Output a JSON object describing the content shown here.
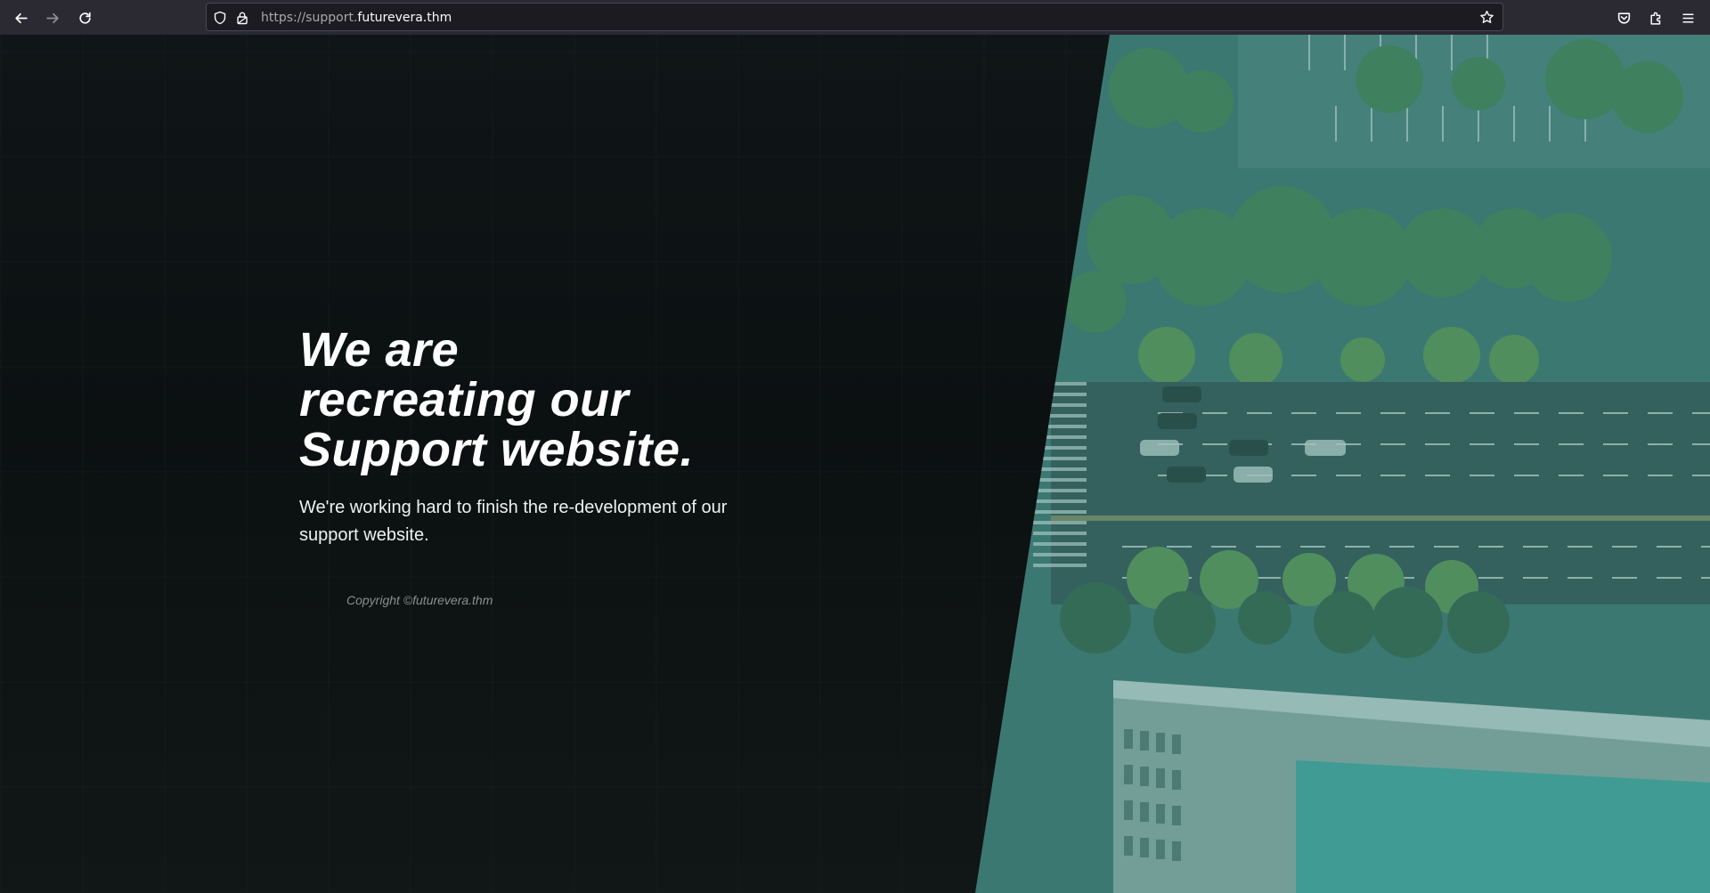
{
  "browser": {
    "url_prefix": "https://support.",
    "url_domain": "futurevera.thm",
    "icons": {
      "back": "back-arrow-icon",
      "forward": "forward-arrow-icon",
      "reload": "reload-icon",
      "tracking_protection": "shield-icon",
      "connection": "lock-icon",
      "bookmark": "star-icon",
      "pocket": "pocket-icon",
      "extensions": "puzzle-icon",
      "menu": "hamburger-menu-icon"
    }
  },
  "page": {
    "headline_lines": [
      "We are",
      "recreating our",
      "Support website."
    ],
    "subtitle": "We're working hard to finish the re-development of our support website.",
    "copyright": "Copyright ©futurevera.thm"
  },
  "colors": {
    "page_background": "#0b0f10",
    "photo_tint": "#3f8c84",
    "headline": "#ffffff",
    "copyright": "#8a8f91"
  }
}
